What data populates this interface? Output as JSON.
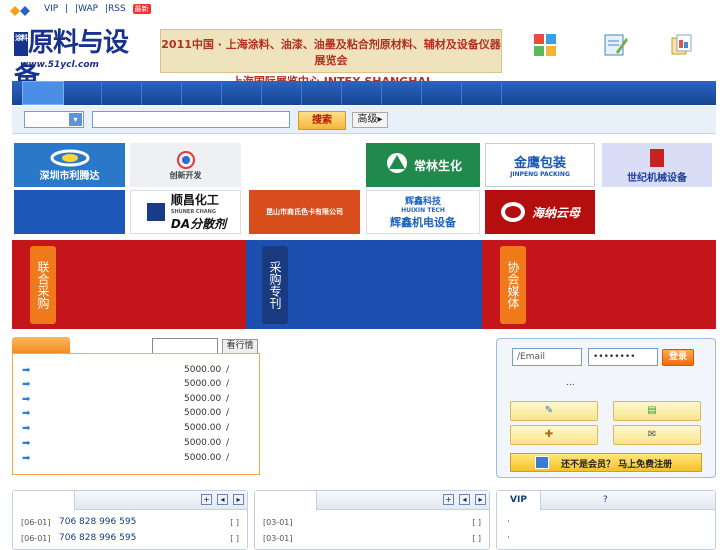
{
  "topbar": {
    "vip": "VIP",
    "sep1": "|",
    "wap": "|WAP",
    "rss": "|RSS",
    "new_badge": "最新"
  },
  "header": {
    "logo_brand": "原料与设备",
    "logo_box": "涂料",
    "logo_url": "www.51ycl.com",
    "expo_line1": "2011中国 · 上海涂料、油漆、油墨及粘合剂原材料、辅材及设备仪器展览会",
    "expo_line2": "上海国际展览中心  INTEX SHANGHAI",
    "tool_icons": [
      "puzzle-icon",
      "notepad-icon",
      "documents-icon"
    ]
  },
  "search": {
    "button": "搜索",
    "advanced": "高级",
    "advanced_arrow": "▸",
    "select_arrow": "▾"
  },
  "ads": {
    "row1": [
      "深圳市利腾达",
      "创新开发",
      "常林生化",
      "金鹰包装",
      "JINPENG PACKING",
      "世纪机械设备"
    ],
    "row2": [
      "顺昌化工",
      "SHUNER CHANG",
      "DA分散剂",
      "昆山市商氏色卡有限公司",
      "辉鑫科技",
      "HUIXIN TECH",
      "辉鑫机电设备",
      "海纳云母"
    ]
  },
  "features": {
    "left": "联合采购",
    "middle": "采购专刊",
    "right": "协会媒体"
  },
  "trade": {
    "quote_button": "看行情",
    "rows": [
      {
        "price": "5000.00",
        "sep": "/"
      },
      {
        "price": "5000.00",
        "sep": "/"
      },
      {
        "price": "5000.00",
        "sep": "/"
      },
      {
        "price": "5000.00",
        "sep": "/"
      },
      {
        "price": "5000.00",
        "sep": "/"
      },
      {
        "price": "5000.00",
        "sep": "/"
      },
      {
        "price": "5000.00",
        "sep": "/"
      }
    ]
  },
  "login": {
    "email_placeholder": "/Email",
    "password_value": "••••••••",
    "button": "登录",
    "ellipsis": "...",
    "register": "还不是会员？  马上免费注册"
  },
  "news": {
    "left_rows": [
      {
        "date": "[06-01]",
        "phone": "706 828 996 595",
        "bracket": "[ ]"
      },
      {
        "date": "[06-01]",
        "phone": "706 828 996 595",
        "bracket": "[ ]"
      }
    ],
    "right_rows": [
      {
        "date": "[03-01]",
        "bracket": "[ ]"
      },
      {
        "date": "[03-01]",
        "bracket": "[ ]"
      }
    ],
    "ctrl_plus": "+",
    "ctrl_prev": "◂",
    "ctrl_next": "▸"
  },
  "vip_panel": {
    "tab": "VIP",
    "tab2": "?",
    "bullet": "·"
  }
}
